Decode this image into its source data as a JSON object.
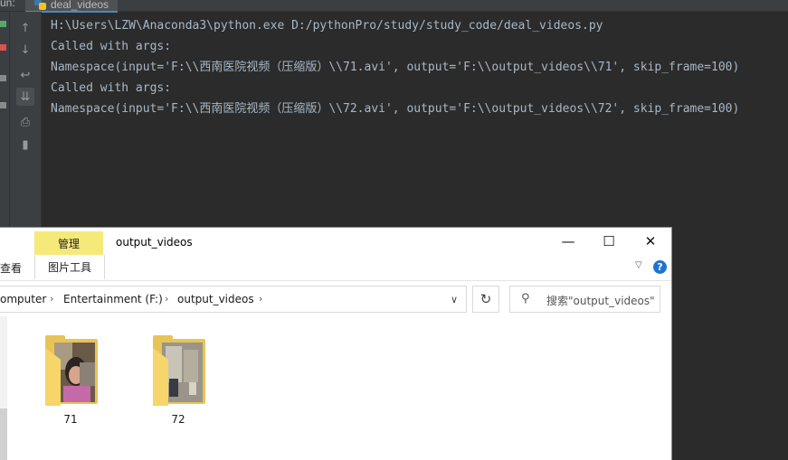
{
  "run_panel": {
    "label": "un:",
    "tab_label": "deal_videos",
    "console_lines": [
      "H:\\Users\\LZW\\Anaconda3\\python.exe D:/pythonPro/study/study_code/deal_videos.py",
      "Called with args:",
      "Namespace(input='F:\\\\西南医院视频（压缩版）\\\\71.avi', output='F:\\\\output_videos\\\\71', skip_frame=100)",
      "Called with args:",
      "Namespace(input='F:\\\\西南医院视频（压缩版）\\\\72.avi', output='F:\\\\output_videos\\\\72', skip_frame=100)"
    ],
    "toolbar_icons": [
      "arrow-up-icon",
      "arrow-down-icon",
      "soft-wrap-icon",
      "scroll-to-end-icon",
      "print-icon",
      "trash-icon"
    ]
  },
  "explorer": {
    "context_tab": "管理",
    "window_title": "output_videos",
    "view_tab": "查看",
    "picture_tools_tab": "图片工具",
    "breadcrumbs": [
      "omputer",
      "Entertainment (F:)",
      "output_videos"
    ],
    "search_placeholder": "搜索\"output_videos\"",
    "folders": [
      {
        "name": "71"
      },
      {
        "name": "72"
      }
    ],
    "colors": {
      "context_tab": "#f5e97a",
      "folder": "#e8c457",
      "help": "#1e74d0"
    }
  }
}
